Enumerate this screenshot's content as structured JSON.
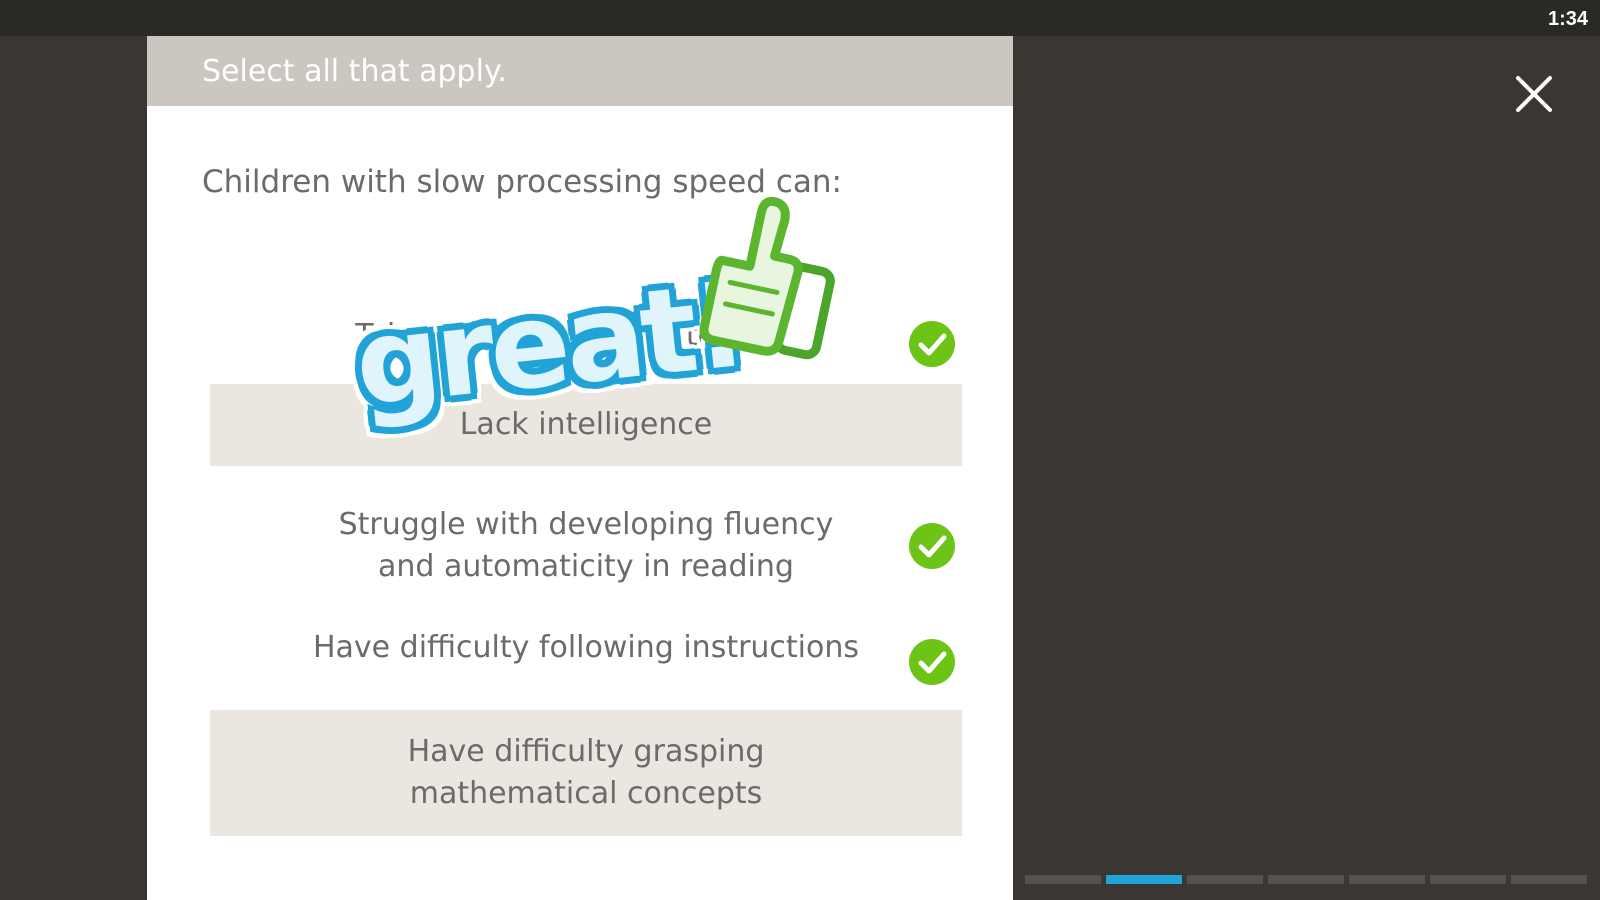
{
  "status_bar": {
    "time": "1:34"
  },
  "quiz": {
    "instruction": "Select all that apply.",
    "question": "Children with slow processing speed can:",
    "options": [
      {
        "label": "Take longer to complete a task",
        "selected": true
      },
      {
        "label": "Lack intelligence",
        "selected": false
      },
      {
        "label": "Struggle with developing fluency and automaticity in reading",
        "selected": true
      },
      {
        "label": "Have difficulty following instructions",
        "selected": true
      },
      {
        "label": "Have difficulty grasping mathematical concepts",
        "selected": false
      }
    ]
  },
  "feedback": {
    "text": "great!",
    "icon": "thumbs-up-icon"
  },
  "progress": {
    "total_segments": 7,
    "current_segment": 2
  },
  "colors": {
    "background": "#3a3733",
    "panel_header": "#cbc7c0",
    "unselected_option": "#ebe7e0",
    "check_green": "#6cc417",
    "progress_active": "#1ea3dd",
    "feedback_blue": "#22a3d8"
  }
}
